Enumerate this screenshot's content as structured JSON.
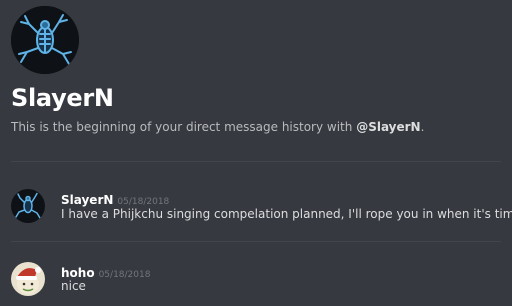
{
  "header": {
    "avatar_icon": "frog-skeleton-icon",
    "name": "SlayerN",
    "intro_prefix": "This is the beginning of your direct message history with ",
    "intro_mention": "@SlayerN",
    "intro_suffix": "."
  },
  "messages": [
    {
      "username": "SlayerN",
      "timestamp": "05/18/2018",
      "text": "I have a Phijkchu singing compelation planned, I'll rope you in when it's time",
      "avatar_icon": "frog-skeleton-icon"
    },
    {
      "username": "hoho",
      "timestamp": "05/18/2018",
      "text": "nice",
      "avatar_icon": "santa-hat-avatar-icon"
    }
  ],
  "colors": {
    "background": "#36393f",
    "divider": "#42454a",
    "username": "#ffffff",
    "timestamp": "#72767d"
  }
}
